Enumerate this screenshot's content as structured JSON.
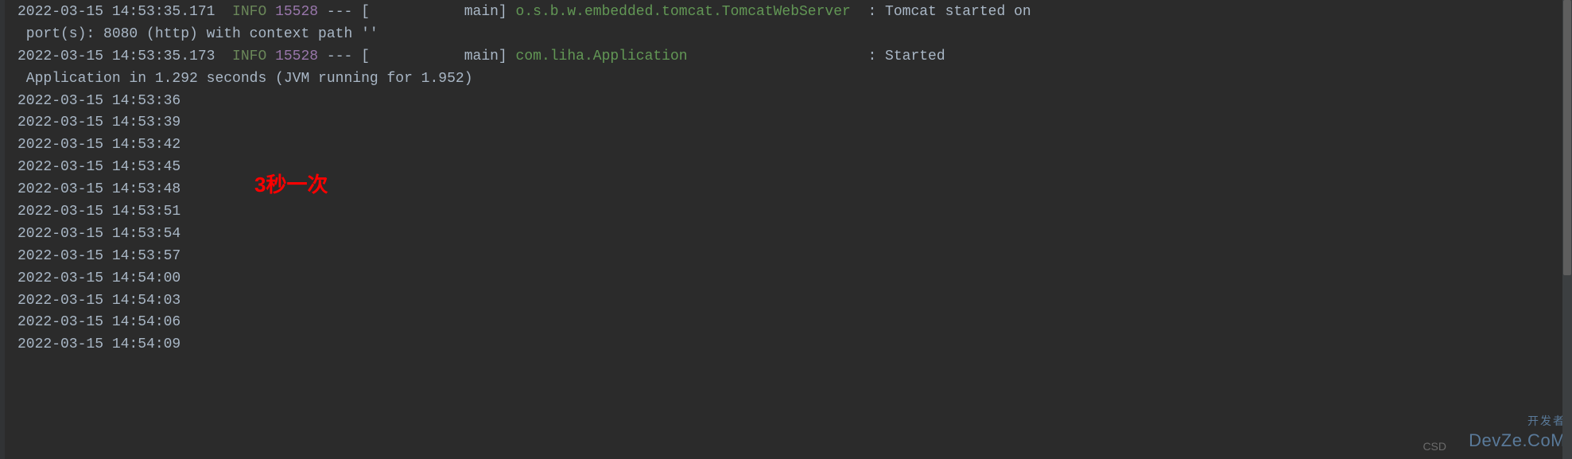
{
  "log_entries": [
    {
      "ts": "2022-03-15 14:53:35.171",
      "level": "INFO",
      "pid": "15528",
      "sep": " --- [           main] ",
      "logger": "o.s.b.w.embedded.tomcat.TomcatWebServer",
      "logger_pad": "  ",
      "msg_prefix": ": ",
      "msg": "Tomcat started on\n port(s): 8080 (http) with context path ''"
    },
    {
      "ts": "2022-03-15 14:53:35.173",
      "level": "INFO",
      "pid": "15528",
      "sep": " --- [           main] ",
      "logger": "com.liha.Application",
      "logger_pad": "                     ",
      "msg_prefix": ": ",
      "msg": "Started\n Application in 1.292 seconds (JVM running for 1.952)"
    }
  ],
  "simple_timestamps": [
    "2022-03-15 14:53:36",
    "2022-03-15 14:53:39",
    "2022-03-15 14:53:42",
    "2022-03-15 14:53:45",
    "2022-03-15 14:53:48",
    "2022-03-15 14:53:51",
    "2022-03-15 14:53:54",
    "2022-03-15 14:53:57",
    "2022-03-15 14:54:00",
    "2022-03-15 14:54:03",
    "2022-03-15 14:54:06",
    "2022-03-15 14:54:09"
  ],
  "annotation": "3秒一次",
  "watermark1_top": "开发者",
  "watermark1_bottom": "DevZe.CoM",
  "watermark2": "CSD"
}
